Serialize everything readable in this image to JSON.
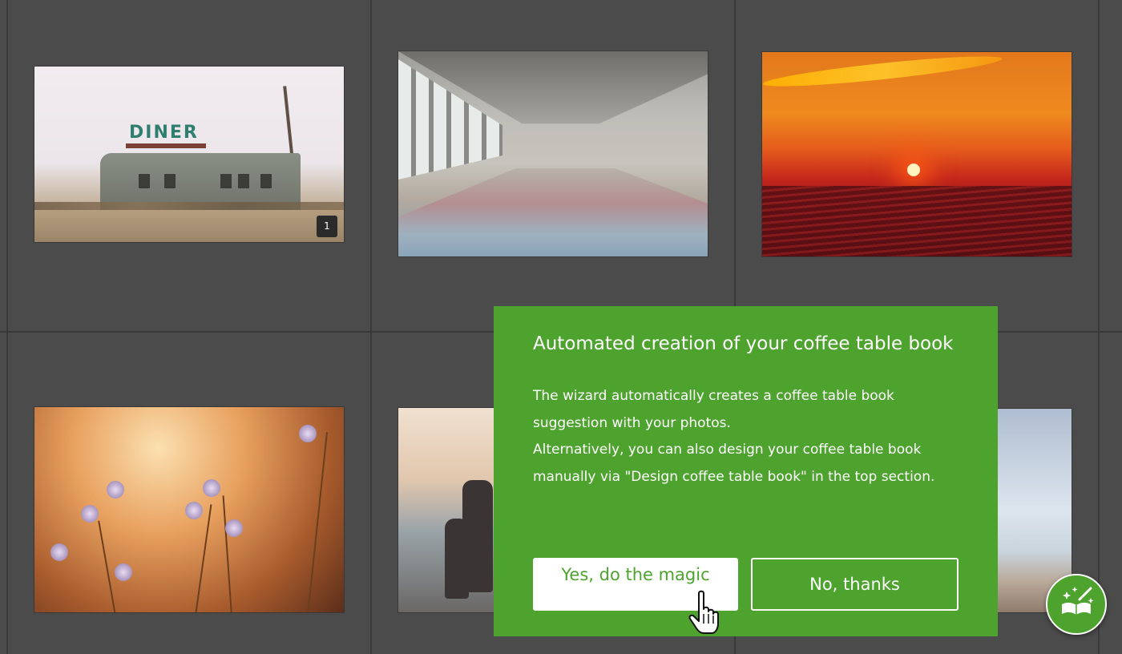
{
  "photos": [
    {
      "name": "diner",
      "badge": "1"
    },
    {
      "name": "abandoned-hall"
    },
    {
      "name": "sunset"
    },
    {
      "name": "flowers"
    },
    {
      "name": "people-walking"
    },
    {
      "name": "beach"
    }
  ],
  "diner_sign": "DINER",
  "wizard_dialog": {
    "title": "Automated creation of your coffee table book",
    "paragraph1": "The wizard automatically creates a coffee table book suggestion with your photos.",
    "paragraph2": "Alternatively, you can also design your coffee table book manually via \"Design coffee table book\" in the top section.",
    "yes_label": "Yes, do the magic",
    "no_label": "No, thanks"
  },
  "icons": {
    "cursor": "hand-pointer-icon",
    "wizard_button": "magic-book-icon"
  },
  "colors": {
    "accent": "#4ea32f",
    "background": "#4b4b4b"
  }
}
